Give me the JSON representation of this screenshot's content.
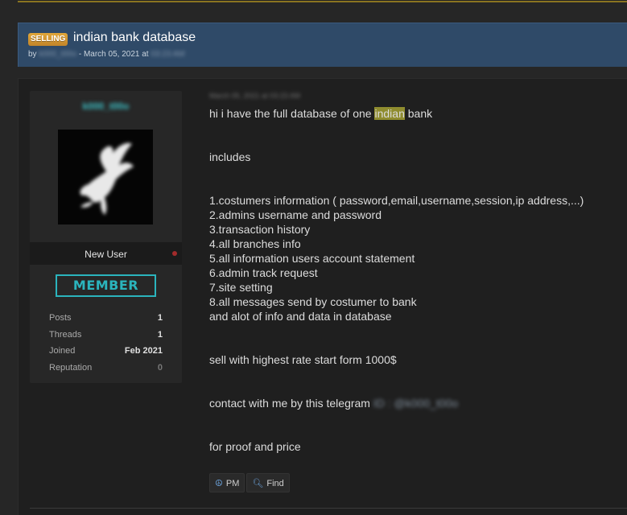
{
  "thread": {
    "prefix": "SELLING",
    "title": "indian bank database",
    "meta_by": "by",
    "meta_author": "k000_t00o",
    "meta_sep": " - ",
    "meta_date": "March 05, 2021",
    "meta_at": "at",
    "meta_time": "03:23 AM"
  },
  "user": {
    "name": "k000_t00o",
    "rank": "New User",
    "badge": "MEMBER",
    "stats": [
      {
        "label": "Posts",
        "value": "1"
      },
      {
        "label": "Threads",
        "value": "1"
      },
      {
        "label": "Joined",
        "value": "Feb 2021"
      },
      {
        "label": "Reputation",
        "value": "0"
      }
    ]
  },
  "post": {
    "date": "March 05, 2021 at 03:23 AM",
    "line1_pre": "hi i have the full database of one ",
    "line1_hl": "indian",
    "line1_post": " bank",
    "includes": "includes",
    "items": [
      "1.costumers information ( password,email,username,session,ip address,...)",
      "2.admins username and password",
      "3.transaction history",
      "4.all branches info",
      "5.all information users account statement",
      "6.admin track request",
      "7.site setting",
      "8.all messages send by costumer to bank",
      "and alot of info and data in database"
    ],
    "sell": "sell with highest rate start form 1000$",
    "contact_pre": "contact with me by this telegram",
    "contact_id": "ID : @k000_t00o",
    "proof": "for proof and price"
  },
  "actions": {
    "pm_label": "PM",
    "find_label": "Find"
  },
  "colors": {
    "header_bg": "#2f4a68",
    "badge_color": "#2bb4bd",
    "highlight": "#8f8c2f",
    "prefix_bg": "#d69934"
  }
}
